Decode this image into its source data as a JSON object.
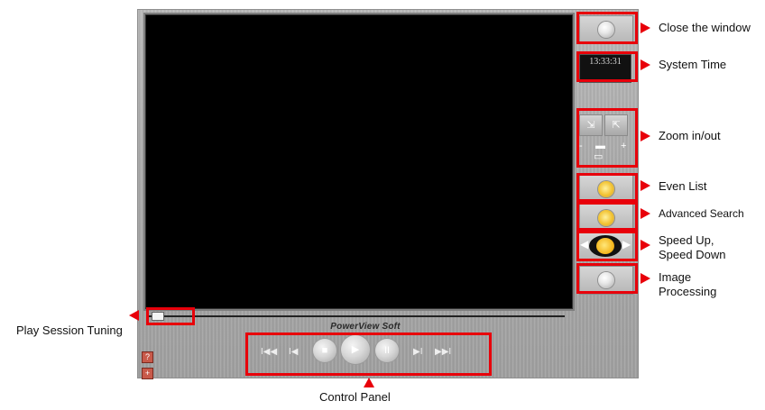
{
  "app": {
    "brand": "PowerView Soft"
  },
  "system_time": "13:33:31",
  "zoom": {
    "minus": "-",
    "plus": "+"
  },
  "controls": {
    "first_label": "I◀◀",
    "prev_label": "I◀",
    "stop_label": "■",
    "play_label": "▶",
    "pause_label": "II",
    "next_label": "▶I",
    "last_label": "▶▶I"
  },
  "progress": {
    "position_fraction": 0.0
  },
  "annotations": {
    "close_window": "Close the window",
    "system_time": "System Time",
    "zoom": "Zoom in/out",
    "even_list": "Even List",
    "advanced_search": "Advanced Search",
    "speed_line1": "Speed Up,",
    "speed_line2": "Speed Down",
    "image_line1": "Image",
    "image_line2": "Processing",
    "play_session": "Play Session Tuning",
    "control_panel": "Control Panel"
  },
  "colors": {
    "highlight": "#e8000a",
    "panel": "#b0b0b0",
    "video": "#000000",
    "accent_yellow": "#f3b61c"
  }
}
